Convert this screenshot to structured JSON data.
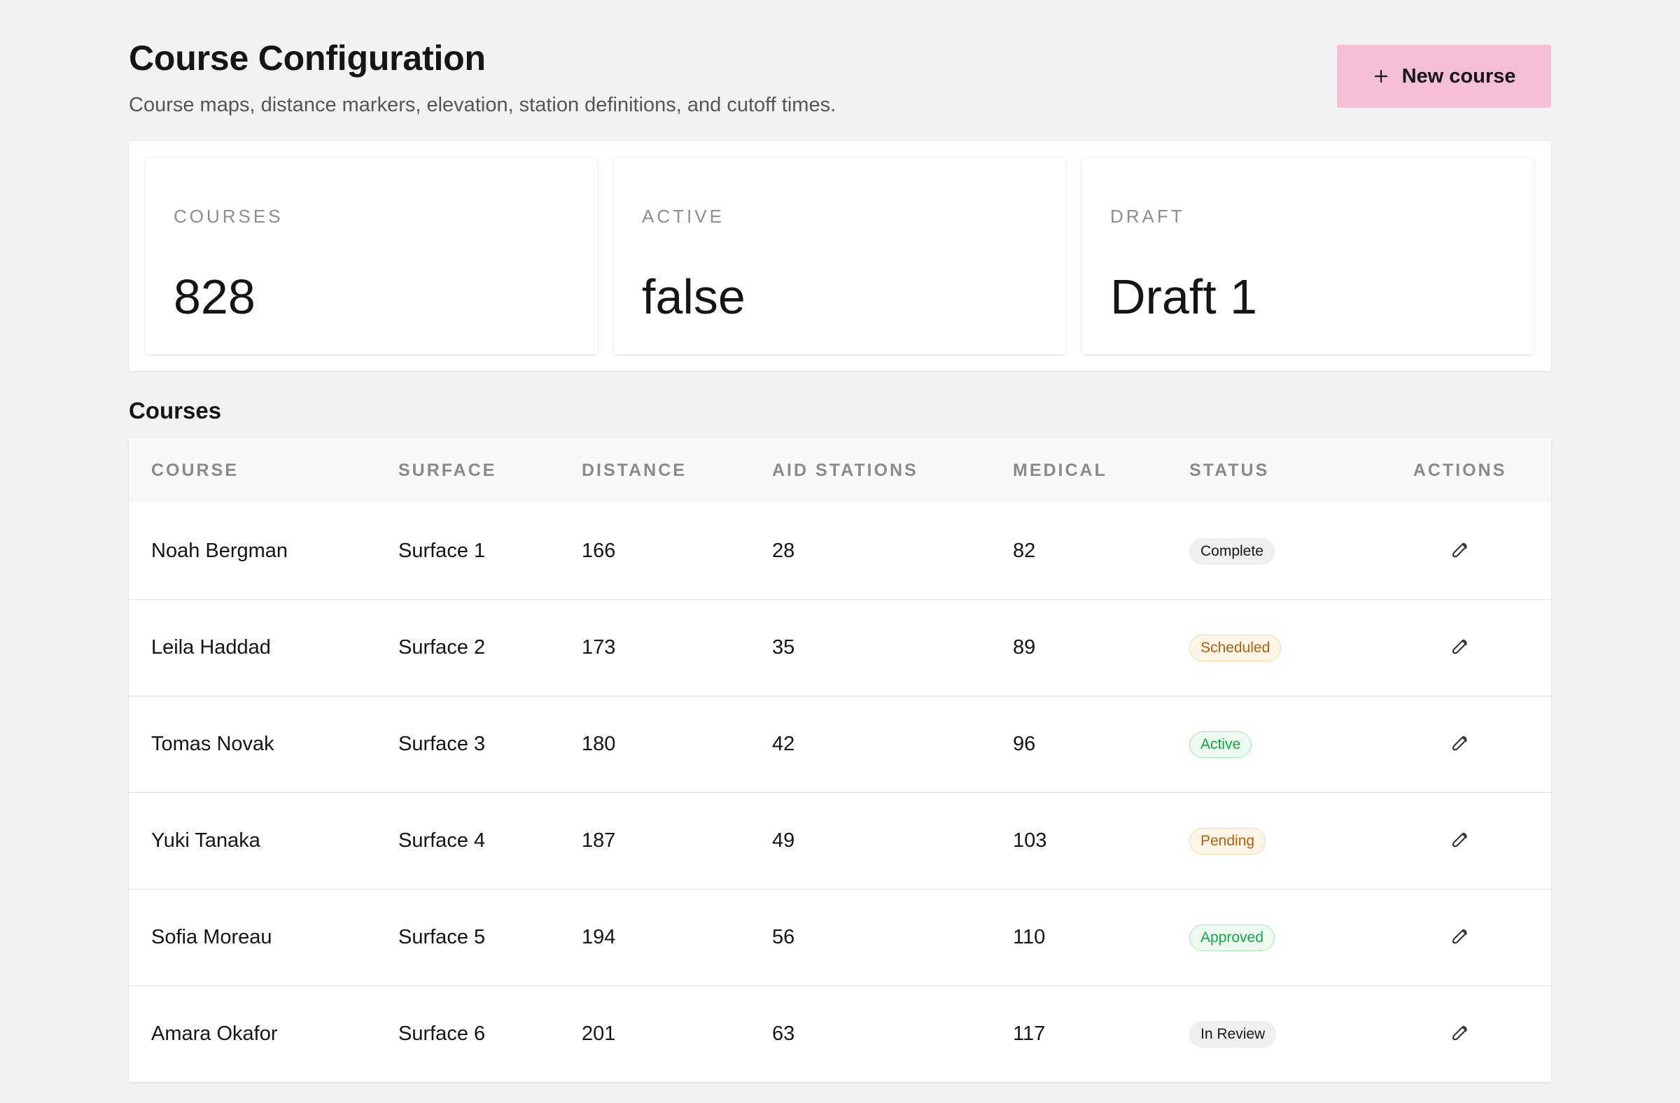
{
  "header": {
    "title": "Course Configuration",
    "subtitle": "Course maps, distance markers, elevation, station definitions, and cutoff times.",
    "new_course_label": "New course"
  },
  "stats": [
    {
      "label": "COURSES",
      "value": "828"
    },
    {
      "label": "ACTIVE",
      "value": "false"
    },
    {
      "label": "DRAFT",
      "value": "Draft 1"
    }
  ],
  "table": {
    "title": "Courses",
    "headers": [
      "COURSE",
      "SURFACE",
      "DISTANCE",
      "AID STATIONS",
      "MEDICAL",
      "STATUS",
      "ACTIONS"
    ],
    "rows": [
      {
        "course": "Noah Bergman",
        "surface": "Surface 1",
        "distance": "166",
        "aid_stations": "28",
        "medical": "82",
        "status": "Complete",
        "status_tone": "neutral"
      },
      {
        "course": "Leila Haddad",
        "surface": "Surface 2",
        "distance": "173",
        "aid_stations": "35",
        "medical": "89",
        "status": "Scheduled",
        "status_tone": "orange"
      },
      {
        "course": "Tomas Novak",
        "surface": "Surface 3",
        "distance": "180",
        "aid_stations": "42",
        "medical": "96",
        "status": "Active",
        "status_tone": "green"
      },
      {
        "course": "Yuki Tanaka",
        "surface": "Surface 4",
        "distance": "187",
        "aid_stations": "49",
        "medical": "103",
        "status": "Pending",
        "status_tone": "orange"
      },
      {
        "course": "Sofia Moreau",
        "surface": "Surface 5",
        "distance": "194",
        "aid_stations": "56",
        "medical": "110",
        "status": "Approved",
        "status_tone": "green"
      },
      {
        "course": "Amara Okafor",
        "surface": "Surface 6",
        "distance": "201",
        "aid_stations": "63",
        "medical": "117",
        "status": "In Review",
        "status_tone": "neutral"
      }
    ]
  },
  "icons": {
    "new_course": "plus-icon",
    "row_action": "pencil-icon"
  },
  "colors": {
    "background": "#f2f2f2",
    "primary_button": "#f4bfd5",
    "status_neutral": "#efefef",
    "status_orange": "#b35d0e",
    "status_green": "#16a34a"
  }
}
